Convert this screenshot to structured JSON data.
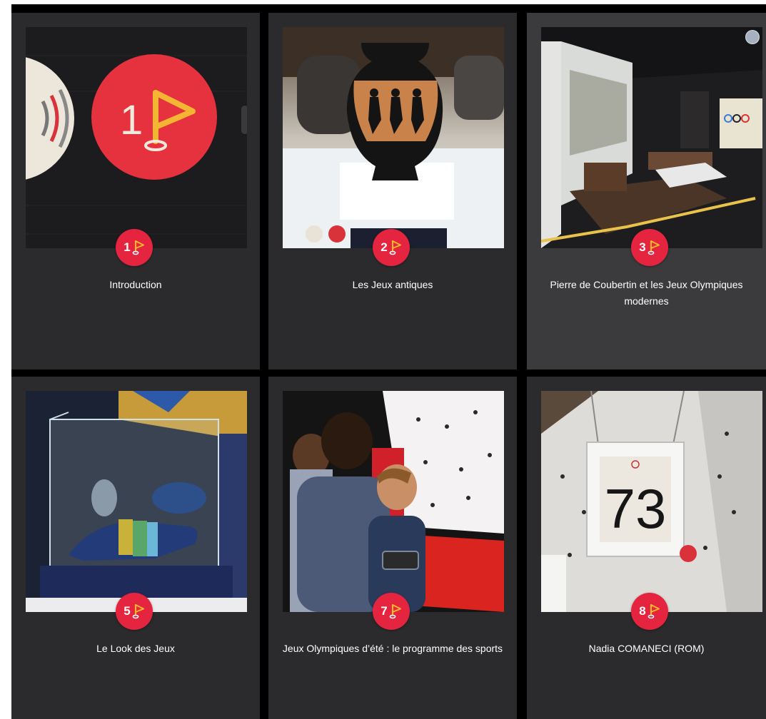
{
  "colors": {
    "card_bg": "#2b2b2d",
    "card_active_bg": "#3b3b3d",
    "badge_red": "#e5243f",
    "flag_yellow": "#f6b72a",
    "title_text": "#ffffff"
  },
  "cards": [
    {
      "number": "1",
      "title": "Introduction",
      "icon": "golf-flag-icon",
      "image": "intro-stop-sign-photo"
    },
    {
      "number": "2",
      "title": "Les Jeux antiques",
      "icon": "golf-flag-icon",
      "image": "ancient-amphora-photo"
    },
    {
      "number": "3",
      "title": "Pierre de Coubertin et les Jeux Olympiques modernes",
      "icon": "golf-flag-icon",
      "image": "coubertin-room-photo"
    },
    {
      "number": "5",
      "title": "Le Look des Jeux",
      "icon": "golf-flag-icon",
      "image": "mascot-display-case-photo"
    },
    {
      "number": "7",
      "title": "Jeux Olympiques d’été : le programme des sports",
      "icon": "golf-flag-icon",
      "image": "children-interactive-wall-photo"
    },
    {
      "number": "8",
      "title": "Nadia COMANECI (ROM)",
      "icon": "golf-flag-icon",
      "image": "bib-73-photo"
    }
  ]
}
